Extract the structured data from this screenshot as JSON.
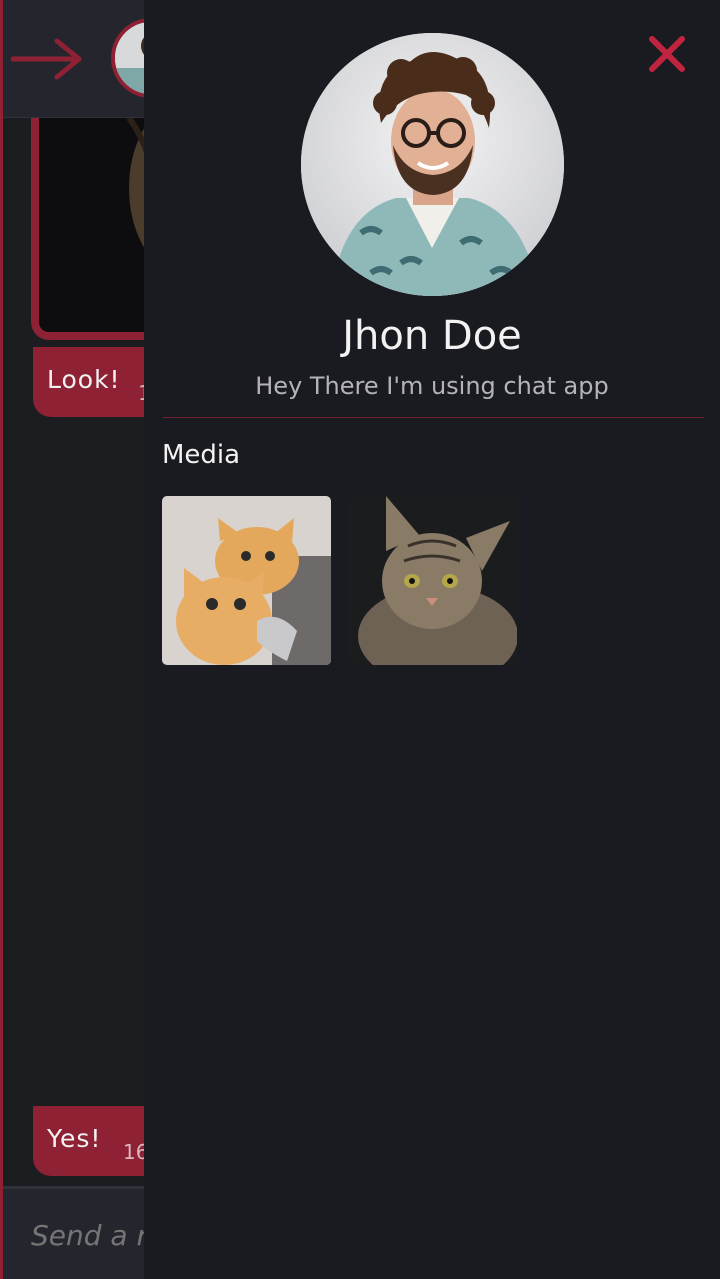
{
  "chat": {
    "messages": [
      {
        "text": "Look!",
        "time": "1"
      },
      {
        "text": "Yes!",
        "time": "16"
      }
    ],
    "send_placeholder": "Send a r"
  },
  "profile": {
    "name": "Jhon Doe",
    "status": "Hey There I'm using chat app",
    "media_title": "Media",
    "media": [
      {
        "subject": "two orange kittens"
      },
      {
        "subject": "tabby cat"
      }
    ]
  },
  "colors": {
    "accent": "#8e2134",
    "close": "#c1243f",
    "background": "#1a1b20",
    "header": "#25262d"
  },
  "icons": {
    "back": "arrow-right-icon",
    "close": "close-icon"
  }
}
